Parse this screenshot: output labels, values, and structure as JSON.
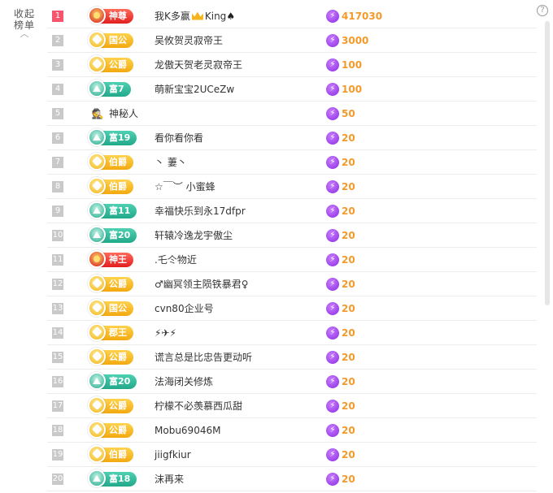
{
  "sidebar": {
    "collapse_label_line1": "收起",
    "collapse_label_line2": "榜单"
  },
  "colors": {
    "rank_top": "#f5556d",
    "score": "#f39a2b",
    "gold_badge": "#f3a910",
    "teal_badge": "#21a88a",
    "red_badge": "#e21f1f"
  },
  "rows": [
    {
      "rank": "1",
      "badge": "神尊",
      "badge_style": "red",
      "name_prefix": "我K多赢",
      "name_suffix": "King",
      "score": "417030"
    },
    {
      "rank": "2",
      "badge": "国公",
      "badge_style": "gold",
      "name": "吴攸贺灵寂帝王",
      "score": "3000"
    },
    {
      "rank": "3",
      "badge": "公爵",
      "badge_style": "gold",
      "name": "龙傲天贺老灵寂帝王",
      "score": "100"
    },
    {
      "rank": "4",
      "badge": "富7",
      "badge_style": "teal",
      "name": "萌新宝宝2UCeZw",
      "score": "100"
    },
    {
      "rank": "5",
      "badge": "",
      "badge_style": "none",
      "name": "神秘人",
      "score": "50"
    },
    {
      "rank": "6",
      "badge": "富19",
      "badge_style": "teal",
      "name": "看你看你看",
      "score": "20"
    },
    {
      "rank": "7",
      "badge": "伯爵",
      "badge_style": "gold",
      "name": "丶 萋丶",
      "score": "20"
    },
    {
      "rank": "8",
      "badge": "伯爵",
      "badge_style": "gold",
      "name": "☆￣︶ 小蜜蜂",
      "score": "20"
    },
    {
      "rank": "9",
      "badge": "富11",
      "badge_style": "teal",
      "name": "幸福快乐到永17dfpr",
      "score": "20"
    },
    {
      "rank": "10",
      "badge": "富20",
      "badge_style": "teal",
      "name": "轩辕冷逸龙宇傲尘",
      "score": "20"
    },
    {
      "rank": "11",
      "badge": "神王",
      "badge_style": "red",
      "name": ".乇仒物近",
      "score": "20"
    },
    {
      "rank": "12",
      "badge": "公爵",
      "badge_style": "gold",
      "name": "♂幽冥领主陨铁暴君♀",
      "score": "20"
    },
    {
      "rank": "13",
      "badge": "国公",
      "badge_style": "gold",
      "name": "cvn80企业号",
      "score": "20"
    },
    {
      "rank": "14",
      "badge": "郡王",
      "badge_style": "gold",
      "name": "⚡✈⚡",
      "score": "20"
    },
    {
      "rank": "15",
      "badge": "公爵",
      "badge_style": "gold",
      "name": "谎言总是比忠告更动听",
      "score": "20"
    },
    {
      "rank": "16",
      "badge": "富20",
      "badge_style": "teal",
      "name": "法海闭关修炼",
      "score": "20"
    },
    {
      "rank": "17",
      "badge": "公爵",
      "badge_style": "gold",
      "name": "柠檬不必羡慕西瓜甜",
      "score": "20"
    },
    {
      "rank": "18",
      "badge": "公爵",
      "badge_style": "gold",
      "name": "Mobu69046M",
      "score": "20"
    },
    {
      "rank": "19",
      "badge": "伯爵",
      "badge_style": "gold",
      "name": "jiigfkiur",
      "score": "20"
    },
    {
      "rank": "20",
      "badge": "富18",
      "badge_style": "teal",
      "name": "沫再来",
      "score": "20"
    }
  ]
}
